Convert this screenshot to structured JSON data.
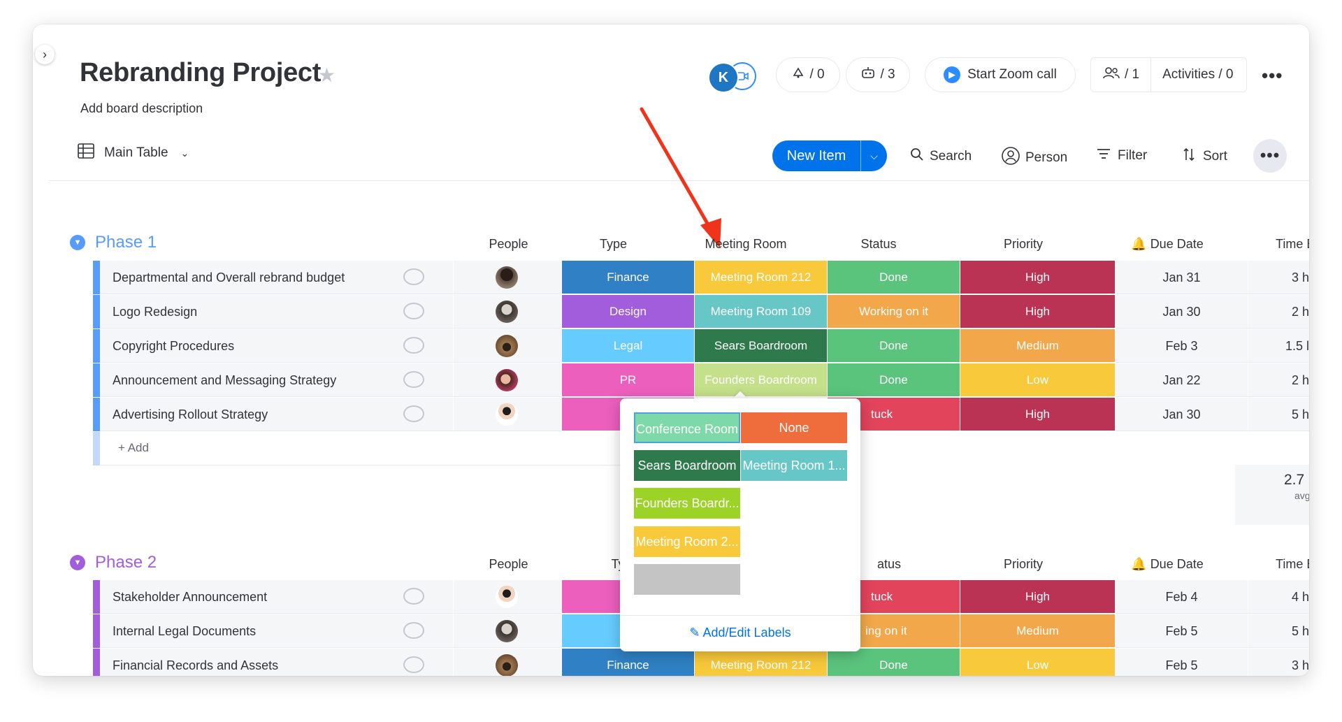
{
  "board": {
    "title": "Rebranding Project",
    "description": "Add board description",
    "view_name": "Main Table"
  },
  "header": {
    "avatar_initial": "K",
    "updates_count": "/ 0",
    "automations_count": "/ 3",
    "zoom_label": "Start Zoom call",
    "members_count": "/ 1",
    "activities_label": "Activities / 0"
  },
  "toolbar": {
    "new_item": "New Item",
    "search": "Search",
    "person": "Person",
    "filter": "Filter",
    "sort": "Sort"
  },
  "columns": {
    "people": "People",
    "type": "Type",
    "meeting_room": "Meeting Room",
    "status": "Status",
    "priority": "Priority",
    "due_date": "Due Date",
    "time": "Time E",
    "type_partial": "Typ",
    "status_partial": "atus"
  },
  "colors": {
    "accent": "#0073ea",
    "phase1": "#579bfc",
    "phase2": "#a25ddc",
    "finance": "#2f80c4",
    "design": "#a25ddc",
    "legal": "#66ccff",
    "pr": "#ec5fbd",
    "done": "#5ac47d",
    "working": "#f2a84a",
    "stuck": "#e2445c",
    "high": "#bb3354",
    "medium": "#f2a84a",
    "low": "#f8c93b",
    "room212": "#f8c93b",
    "room109": "#67c7c7",
    "sears": "#2f7a4d",
    "founders": "#9cd326"
  },
  "group1": {
    "title": "Phase 1",
    "add_label": "+ Add",
    "summary_value": "2.7",
    "summary_label": "avg",
    "rows": [
      {
        "name": "Departmental and Overall rebrand budget",
        "type": "Finance",
        "room": "Meeting Room 212",
        "status": "Done",
        "priority": "High",
        "due": "Jan 31",
        "time": "3 h"
      },
      {
        "name": "Logo Redesign",
        "type": "Design",
        "room": "Meeting Room 109",
        "status": "Working on it",
        "priority": "High",
        "due": "Jan 30",
        "time": "2 h"
      },
      {
        "name": "Copyright Procedures",
        "type": "Legal",
        "room": "Sears Boardroom",
        "status": "Done",
        "priority": "Medium",
        "due": "Feb 3",
        "time": "1.5 l"
      },
      {
        "name": "Announcement and Messaging Strategy",
        "type": "PR",
        "room": "Founders Boardroom",
        "status": "Done",
        "priority": "Low",
        "due": "Jan 22",
        "time": "2 h"
      },
      {
        "name": "Advertising Rollout Strategy",
        "type": "PR",
        "room": "",
        "status": "tuck",
        "priority": "High",
        "due": "Jan 30",
        "time": "5 h"
      }
    ]
  },
  "group2": {
    "title": "Phase 2",
    "rows": [
      {
        "name": "Stakeholder Announcement",
        "type": "PR",
        "room": "",
        "status": "tuck",
        "priority": "High",
        "due": "Feb 4",
        "time": "4 h"
      },
      {
        "name": "Internal Legal Documents",
        "type": "Lega",
        "room": "",
        "status": "ing on it",
        "priority": "Medium",
        "due": "Feb 5",
        "time": "5 h"
      },
      {
        "name": "Financial Records and Assets",
        "type": "Finance",
        "room": "Meeting Room 212",
        "status": "Done",
        "priority": "Low",
        "due": "Feb 5",
        "time": "3 h"
      }
    ]
  },
  "label_picker": {
    "labels": [
      "Conference Room",
      "None",
      "Sears Boardroom",
      "Meeting Room 1...",
      "Founders Boardr...",
      "Meeting Room 2...",
      ""
    ],
    "add_edit": "Add/Edit Labels"
  },
  "icons": [
    "chevron-right-icon",
    "star-icon",
    "updates-icon",
    "robot-icon",
    "zoom-icon",
    "people-icon",
    "table-icon",
    "chevron-down-icon",
    "search-icon",
    "person-icon",
    "filter-icon",
    "sort-icon",
    "comment-icon",
    "bell-icon",
    "pencil-icon",
    "arrow-annotation"
  ]
}
